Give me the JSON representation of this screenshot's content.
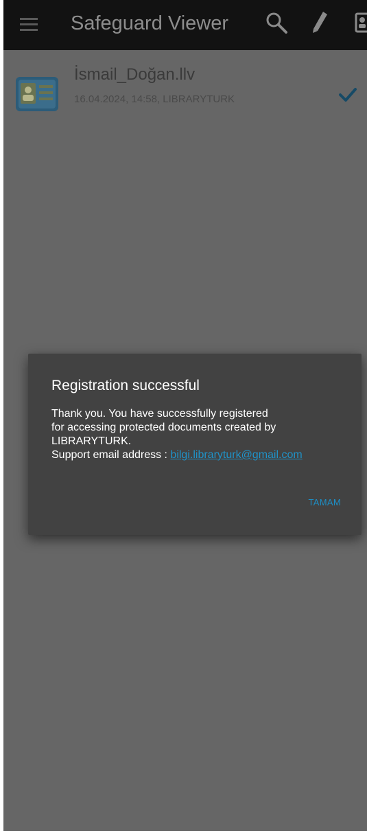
{
  "appbar": {
    "title": "Safeguard Viewer",
    "icons": [
      "menu-icon",
      "search-icon",
      "pencil-icon",
      "account-icon"
    ]
  },
  "file_list": [
    {
      "name": "İsmail_Doğan.llv",
      "meta": "16.04.2024, 14:58, LIBRARYTURK",
      "icon": "id-card-icon",
      "status_icon": "check-icon"
    }
  ],
  "dialog": {
    "title": "Registration successful",
    "lines": [
      "Thank you. You have successfully registered",
      "for accessing protected documents created by",
      "LIBRARYTURK."
    ],
    "support_label": "Support email address : ",
    "support_email": "bilgi.libraryturk@gmail.com",
    "ok_label": "TAMAM"
  },
  "colors": {
    "appbar": "#121212",
    "dim_background": "#666666",
    "dialog": "#424242",
    "accent": "#1d8fc6"
  }
}
